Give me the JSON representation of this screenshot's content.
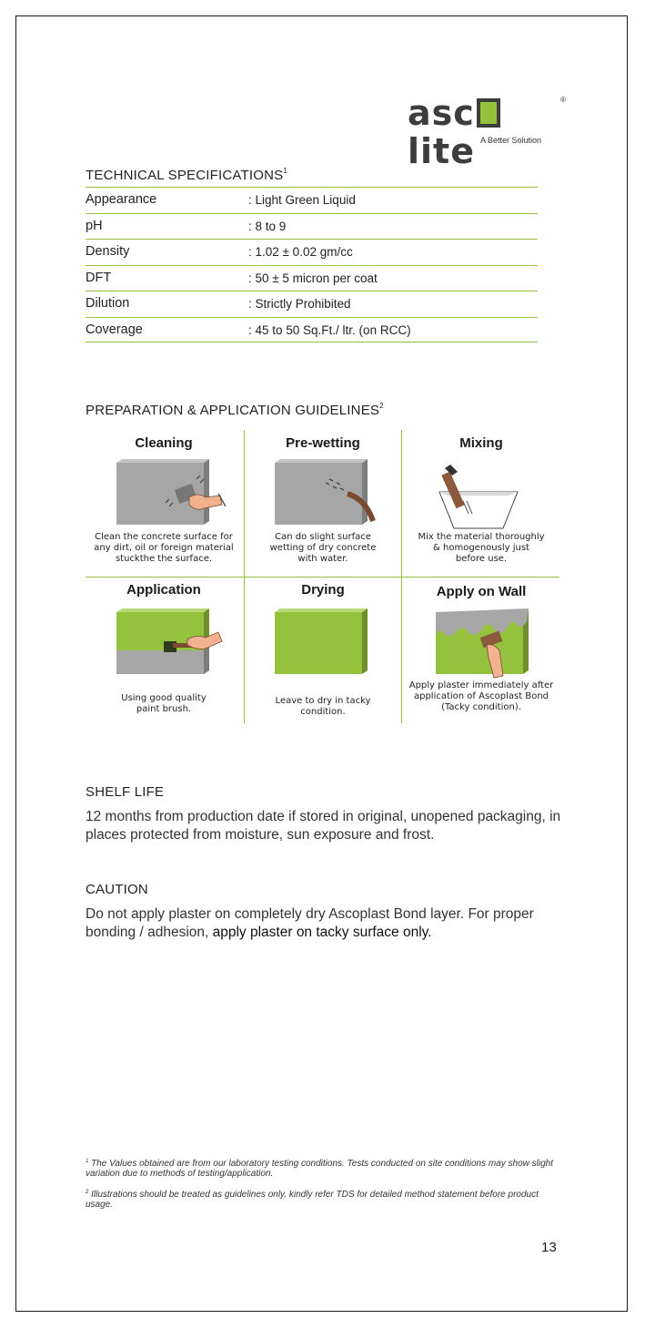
{
  "logo": {
    "pre": "asc",
    "green_letter": "o",
    "post": "lite",
    "reg": "®",
    "tagline": "A Better Solution"
  },
  "tech_specs": {
    "heading": "TECHNICAL SPECIFICATIONS",
    "footnote_mark": "1",
    "rows": [
      {
        "label": "Appearance",
        "value": ": Light Green Liquid"
      },
      {
        "label": "pH",
        "value": ": 8 to 9"
      },
      {
        "label": "Density",
        "value": ": 1.02 ±  0.02 gm/cc"
      },
      {
        "label": "DFT",
        "value": ": 50 ±  5 micron per coat"
      },
      {
        "label": "Dilution",
        "value": ": Strictly Prohibited"
      },
      {
        "label": "Coverage",
        "value": ": 45 to 50 Sq.Ft./ ltr. (on RCC)"
      }
    ]
  },
  "guidelines": {
    "heading": "PREPARATION & APPLICATION GUIDELINES",
    "footnote_mark": "2",
    "steps": [
      {
        "title": "Cleaning",
        "desc": [
          "Clean the concrete surface for",
          "any dirt, oil or foreign material",
          "stuckthe the surface."
        ],
        "icon": "cleaning-illustration"
      },
      {
        "title": "Pre-wetting",
        "desc": [
          "Can do slight surface",
          "wetting of dry concrete",
          "with water."
        ],
        "icon": "pre-wetting-illustration"
      },
      {
        "title": "Mixing",
        "desc": [
          "Mix the material thoroughly",
          "& homogenously just",
          "before use."
        ],
        "icon": "mixing-illustration"
      },
      {
        "title": "Application",
        "desc": [
          "Using good quality",
          "paint brush."
        ],
        "icon": "application-illustration"
      },
      {
        "title": "Drying",
        "desc": [
          "Leave to dry in tacky",
          "condition."
        ],
        "icon": "drying-illustration"
      },
      {
        "title": "Apply on Wall",
        "desc": [
          "Apply plaster immediately after",
          "application of Ascoplast Bond",
          "(Tacky condition)."
        ],
        "icon": "apply-on-wall-illustration"
      }
    ]
  },
  "shelf_life": {
    "heading": "SHELF LIFE",
    "text": "12 months from production date if stored in original, unopened packaging, in places protected from moisture, sun exposure and frost."
  },
  "caution": {
    "heading": "CAUTION",
    "text": "Do not apply plaster on completely dry Ascoplast Bond layer. For proper bonding / adhesion, ",
    "emphasis": "apply plaster on tacky surface only."
  },
  "footnotes": [
    {
      "mark": "1",
      "text": "The Values obtained are from our laboratory testing conditions. Tests conducted on site conditions may show slight variation due to methods of testing/application."
    },
    {
      "mark": "2",
      "text": "Illustrations should be treated as guidelines only, kindly refer TDS for detailed method statement before product usage."
    }
  ],
  "page_number": "13",
  "colors": {
    "accent_green": "#95c23d",
    "concrete_gray": "#a6a6a6",
    "text": "#222222"
  }
}
